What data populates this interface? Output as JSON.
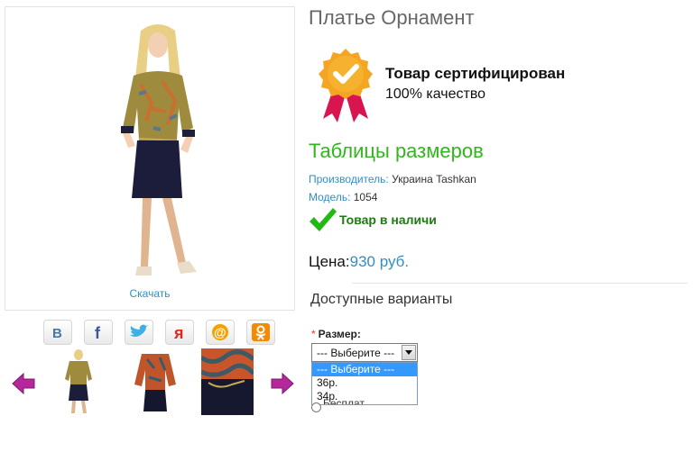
{
  "product": {
    "title": "Платье Орнамент",
    "download_label": "Скачать"
  },
  "certificate": {
    "title": "Товар сертифицирован",
    "subtitle": "100% качество",
    "badge_color": "#f4a623",
    "ribbon_color": "#d8154f"
  },
  "size_table_link": "Таблицы размеров",
  "meta": {
    "manufacturer_label": "Производитель:",
    "manufacturer_value": "Украина Tashkan",
    "model_label": "Модель:",
    "model_value": "1054"
  },
  "stock": {
    "text": "Товар в наличи",
    "icon": "checkmark-icon",
    "color": "#1e7a12"
  },
  "price": {
    "label": "Цена:",
    "value": "930 руб."
  },
  "variants": {
    "heading": "Доступные варианты",
    "size_label": "Размер:",
    "selected": "--- Выберите ---",
    "options": [
      "--- Выберите ---",
      "36р.",
      "34р."
    ],
    "hidden_option_label": "Бесплат"
  },
  "social": [
    "vk-icon",
    "facebook-icon",
    "twitter-icon",
    "yandex-icon",
    "mail-ru-icon",
    "odnoklassniki-icon"
  ],
  "colors": {
    "accent_blue": "#2f8fc4",
    "accent_green": "#2fb71b",
    "arrow_purple": "#b5289c"
  }
}
